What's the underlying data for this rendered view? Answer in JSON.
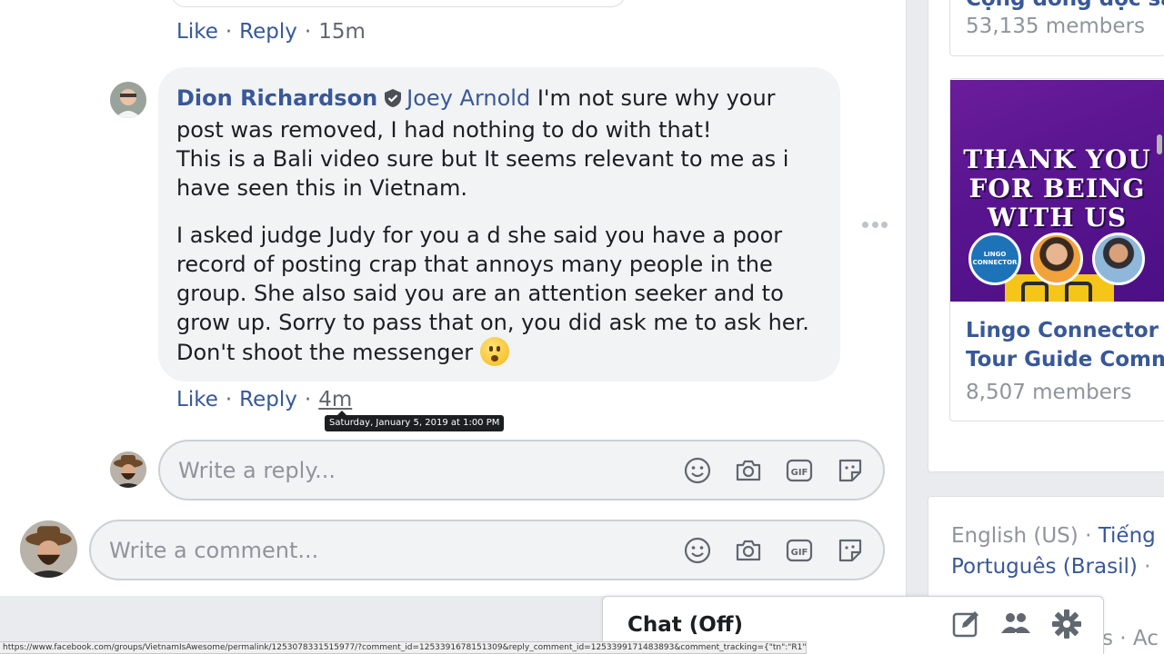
{
  "previous_comment": {
    "like_label": "Like",
    "reply_label": "Reply",
    "time": "15m",
    "separator": "·"
  },
  "comment": {
    "author": "Dion Richardson",
    "mention": "Joey Arnold",
    "line1_rest": " I'm not sure why your post was removed, I had nothing to do with that!",
    "line2": "This is a Bali video sure but It seems relevant to me as i have seen this in Vietnam.",
    "paragraph2": "I asked judge Judy for you a d she said you have a poor record of posting crap that annoys many people in the group. She also said you are an attention seeker and to grow up. Sorry to pass that on, you did ask me to ask her. Don't shoot the messenger",
    "emoji": "hushed-face-emoji",
    "like_label": "Like",
    "reply_label": "Reply",
    "time": "4m",
    "time_tooltip": "Saturday, January 5, 2019 at 1:00 PM"
  },
  "reply_composer": {
    "placeholder": "Write a reply...",
    "icons": [
      "smiley-icon",
      "camera-icon",
      "gif-icon",
      "sticker-icon"
    ]
  },
  "comment_composer": {
    "placeholder": "Write a comment..."
  },
  "sidebar": {
    "group_top": {
      "name_partial": "Cộng đồng độc sắ",
      "members": "53,135 members"
    },
    "ad_group": {
      "image_headline": "THANK YOU FOR BEING WITH US",
      "logo_text": "LINGO CONNECTOR",
      "name_line1": "Lingo Connector -",
      "name_line2": "Tour Guide Commu",
      "members": "8,507 members"
    },
    "languages": {
      "lang1": "English (US)",
      "lang2": "Tiếng",
      "lang3": "Português (Brasil)",
      "sep": "·",
      "partial_footer": "s · Ac"
    }
  },
  "chat": {
    "title": "Chat (Off)",
    "icons": [
      "compose-icon",
      "group-icon",
      "gear-icon"
    ]
  },
  "status_url": "https://www.facebook.com/groups/VietnamIsAwesome/permalink/1253078331515977/?comment_id=1253391678151309&reply_comment_id=1253399171483893&comment_tracking={\"tn\":\"R1\"}",
  "colors": {
    "link_blue": "#385898",
    "bubble_bg": "#f2f3f5",
    "meta_gray": "#606770",
    "ad_purple": "#5a1590"
  }
}
